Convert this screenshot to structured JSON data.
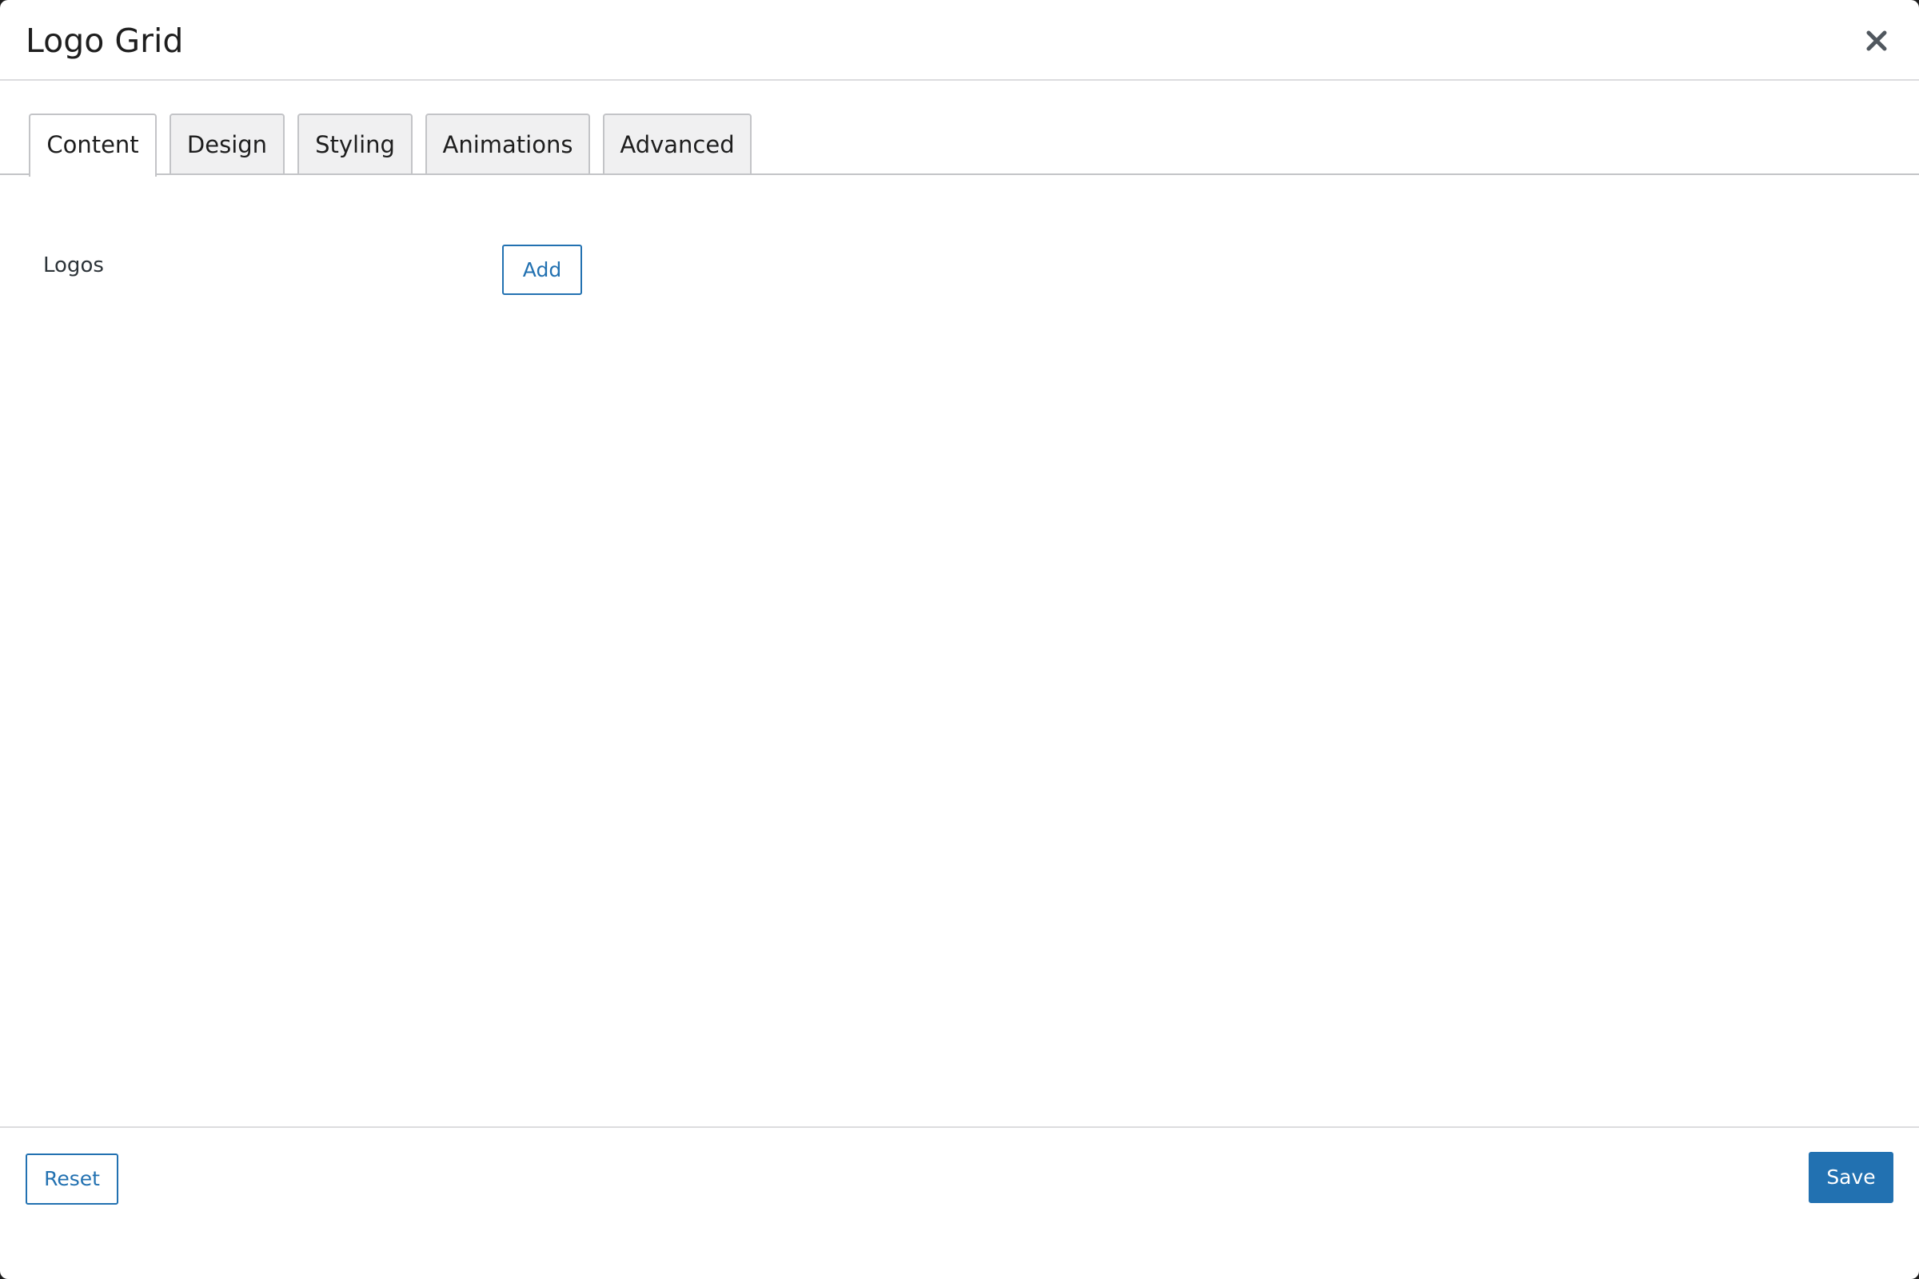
{
  "dialog": {
    "title": "Logo Grid",
    "close_icon": "close-icon"
  },
  "tabs": [
    {
      "label": "Content",
      "active": true
    },
    {
      "label": "Design",
      "active": false
    },
    {
      "label": "Styling",
      "active": false
    },
    {
      "label": "Animations",
      "active": false
    },
    {
      "label": "Advanced",
      "active": false
    }
  ],
  "content": {
    "logos_label": "Logos",
    "add_label": "Add"
  },
  "footer": {
    "reset_label": "Reset",
    "save_label": "Save"
  },
  "colors": {
    "accent": "#2271b1",
    "border": "#c3c4c7",
    "tab_inactive_bg": "#f0f0f1",
    "text": "#1e1e1e"
  }
}
